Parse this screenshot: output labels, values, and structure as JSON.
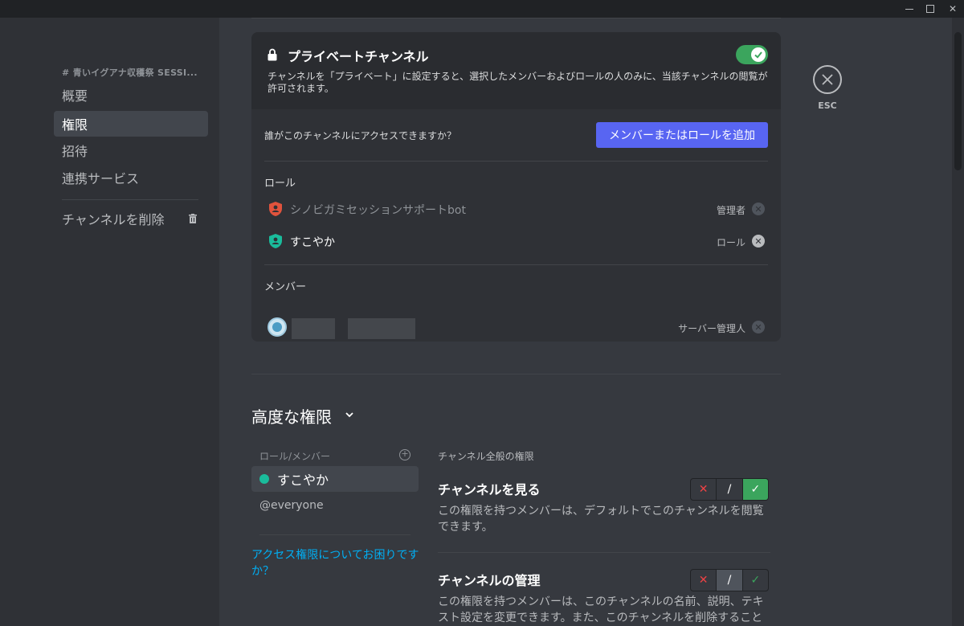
{
  "window": {
    "minimize": "—",
    "maximize": "☐",
    "close": "✕"
  },
  "sidebar": {
    "header": "# 青いイグアナ収穫祭 SESSI...",
    "items": [
      {
        "label": "概要"
      },
      {
        "label": "権限"
      },
      {
        "label": "招待"
      },
      {
        "label": "連携サービス"
      }
    ],
    "delete_label": "チャンネルを削除"
  },
  "private": {
    "title": "プライベートチャンネル",
    "description": "チャンネルを「プライベート」に設定すると、選択したメンバーおよびロールの人のみに、当該チャンネルの閲覧が許可されます。",
    "enabled": true,
    "access_question": "誰がこのチャンネルにアクセスできますか？",
    "add_button": "メンバーまたはロールを追加",
    "roles_label": "ロール",
    "roles": [
      {
        "name": "シノビガミセッションサポートbot",
        "tag": "管理者",
        "color": "#e0533d"
      },
      {
        "name": "すこやか",
        "tag": "ロール",
        "color": "#1abc9c"
      }
    ],
    "members_label": "メンバー",
    "members": [
      {
        "tag": "サーバー管理人"
      }
    ]
  },
  "esc": {
    "label": "ESC"
  },
  "advanced": {
    "title": "高度な権限",
    "list_header": "ロール/メンバー",
    "items": [
      {
        "label": "すこやか"
      },
      {
        "label": "@everyone"
      }
    ],
    "help_link": "アクセス権限についてお困りですか？",
    "perm_section": "チャンネル全般の権限",
    "permissions": [
      {
        "title": "チャンネルを見る",
        "description": "この権限を持つメンバーは、デフォルトでこのチャンネルを閲覧できます。",
        "state": "allow"
      },
      {
        "title": "チャンネルの管理",
        "description": "この権限を持つメンバーは、このチャンネルの名前、説明、テキスト設定を変更できます。また、このチャンネルを削除すること",
        "state": "neutral"
      }
    ],
    "deny_symbol": "✕",
    "neutral_symbol": "/",
    "allow_symbol": "✓"
  }
}
